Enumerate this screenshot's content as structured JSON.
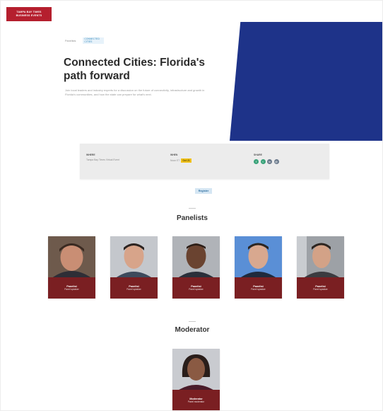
{
  "brand": {
    "line1": "TAMPA BAY TIMES",
    "line2": "BUSINESS EVENTS"
  },
  "hero": {
    "tag_plain": "Panelists",
    "tag_pill": "CONNECTED CITIES",
    "title": "Connected Cities: Florida's path forward",
    "description": "Join local leaders and industry experts for a discussion on the future of connectivity, infrastructure and growth in Florida's communities, and how the state can prepare for what's next."
  },
  "info": {
    "where_label": "WHERE",
    "where_text": "Tampa Bay Times Virtual Event",
    "when_label": "WHEN",
    "when_date": "Oct 21",
    "when_time": "Noon ET",
    "share_label": "SHARE",
    "share_icons": [
      "facebook-icon",
      "twitter-icon",
      "linkedin-icon",
      "email-icon"
    ]
  },
  "register_label": "Register",
  "panelists_heading": "Panelists",
  "panelists": [
    {
      "name": "Panelist",
      "title": "Panel speaker"
    },
    {
      "name": "Panelist",
      "title": "Panel speaker"
    },
    {
      "name": "Panelist",
      "title": "Panel speaker"
    },
    {
      "name": "Panelist",
      "title": "Panel speaker"
    },
    {
      "name": "Panelist",
      "title": "Panel speaker"
    }
  ],
  "moderator_heading": "Moderator",
  "moderator": {
    "name": "Moderator",
    "title": "Panel moderator"
  },
  "colors": {
    "brand_red": "#b51f2e",
    "hero_blue": "#1e3389",
    "card_plate": "#7a1f22",
    "accent_yellow": "#f1c21b",
    "share_green": "#3aa37a",
    "share_grey": "#6b7a8c"
  }
}
